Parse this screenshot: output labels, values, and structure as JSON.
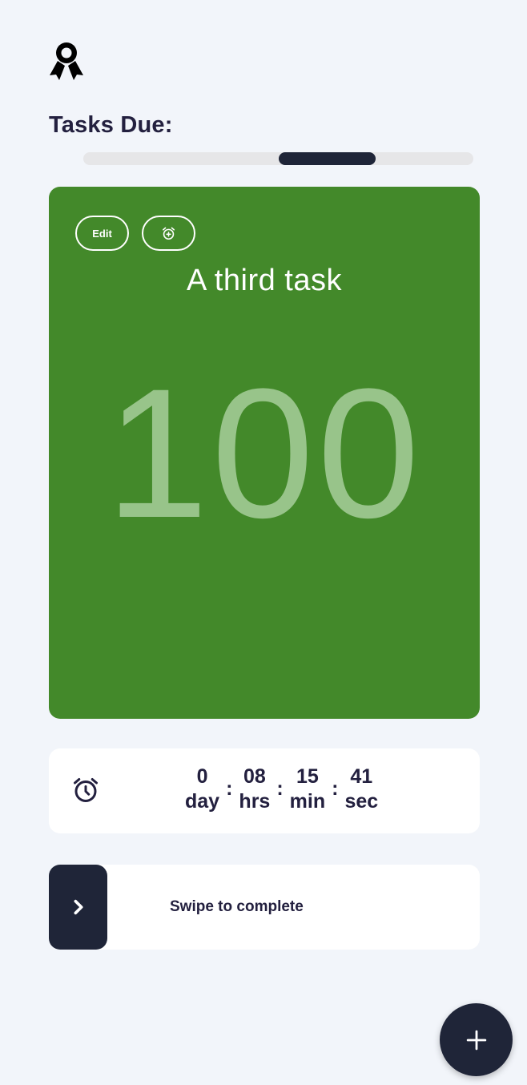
{
  "header": {
    "logo_icon": "award-ribbon-icon",
    "title": "Tasks Due:"
  },
  "pager": {
    "position_fraction": 0.5,
    "thumb_fraction": 0.25
  },
  "task": {
    "edit_label": "Edit",
    "alarm_icon": "alarm-add-icon",
    "title": "A third task",
    "score": "100",
    "card_color": "#43892a",
    "score_color": "#98c48a"
  },
  "countdown": {
    "icon": "alarm-clock-icon",
    "units": [
      {
        "value": "0",
        "unit": "day"
      },
      {
        "value": "08",
        "unit": "hrs"
      },
      {
        "value": "15",
        "unit": "min"
      },
      {
        "value": "41",
        "unit": "sec"
      }
    ],
    "separator": ":"
  },
  "swipe": {
    "handle_icon": "chevron-right-icon",
    "label": "Swipe to complete"
  },
  "fab": {
    "icon": "plus-icon"
  },
  "colors": {
    "background": "#f2f5fa",
    "dark": "#1f2538",
    "text": "#23203f"
  }
}
